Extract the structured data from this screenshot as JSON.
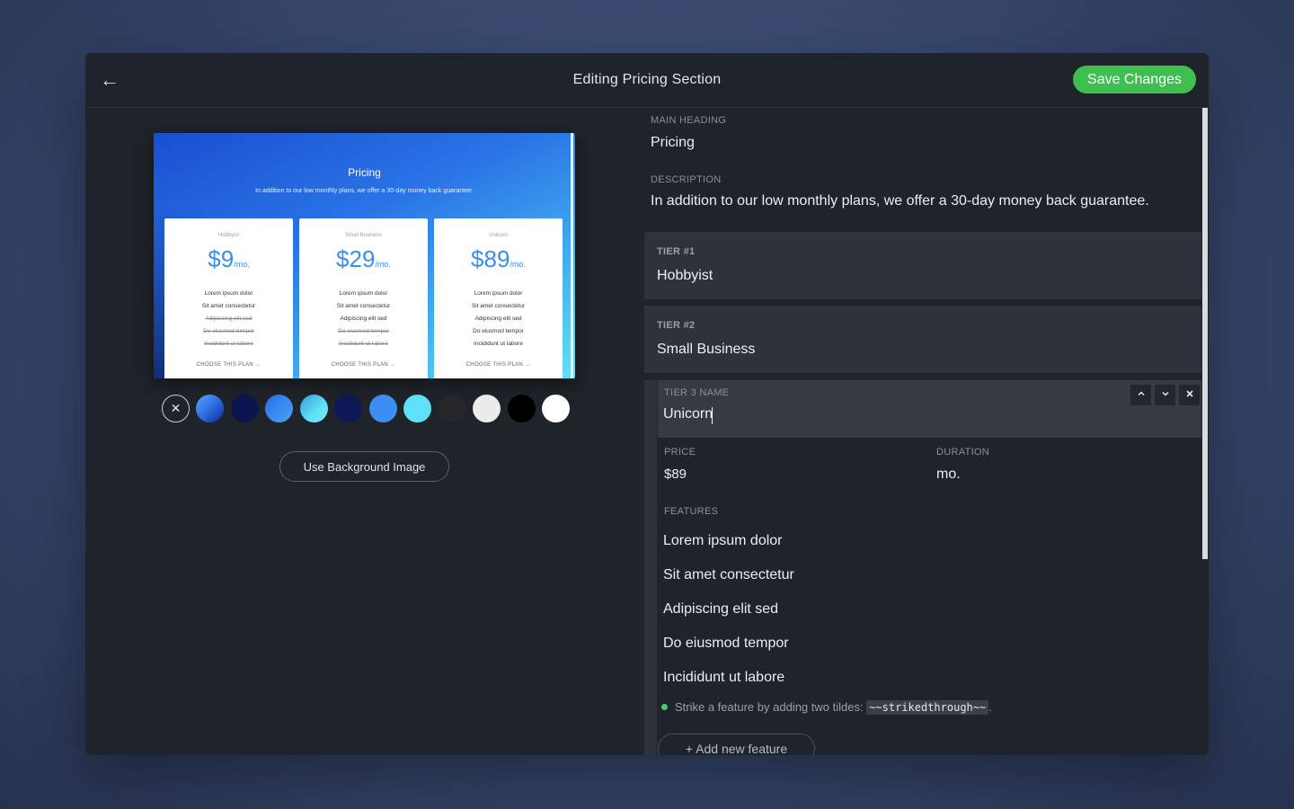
{
  "header": {
    "back_icon": "←",
    "title": "Editing Pricing Section",
    "save_label": "Save Changes"
  },
  "preview": {
    "title": "Pricing",
    "description": "In addition to our low monthly plans, we offer a 30-day money back guarantee.",
    "cards": [
      {
        "tier": "Hobbyist",
        "price": "$9",
        "per": "/mo.",
        "cta": "CHOOSE THIS PLAN →",
        "features": [
          {
            "text": "Lorem ipsum dolor",
            "struck": false
          },
          {
            "text": "Sit amet consectetur",
            "struck": false
          },
          {
            "text": "Adipiscing elit sed",
            "struck": true
          },
          {
            "text": "Do eiusmod tempor",
            "struck": true
          },
          {
            "text": "Incididunt ut labore",
            "struck": true
          }
        ]
      },
      {
        "tier": "Small Business",
        "price": "$29",
        "per": "/mo.",
        "cta": "CHOOSE THIS PLAN →",
        "features": [
          {
            "text": "Lorem ipsum dolor",
            "struck": false
          },
          {
            "text": "Sit amet consectetur",
            "struck": false
          },
          {
            "text": "Adipiscing elit sed",
            "struck": false
          },
          {
            "text": "Do eiusmod tempor",
            "struck": true
          },
          {
            "text": "Incididunt ut labore",
            "struck": true
          }
        ]
      },
      {
        "tier": "Unicorn",
        "price": "$89",
        "per": "/mo.",
        "cta": "CHOOSE THIS PLAN →",
        "features": [
          {
            "text": "Lorem ipsum dolor",
            "struck": false
          },
          {
            "text": "Sit amet consectetur",
            "struck": false
          },
          {
            "text": "Adipiscing elit sed",
            "struck": false
          },
          {
            "text": "Do eiusmod tempor",
            "struck": false
          },
          {
            "text": "Incididunt ut labore",
            "struck": false
          }
        ]
      }
    ]
  },
  "swatches": {
    "clear_icon": "✕",
    "colors": [
      "gradient-blue",
      "#0c1450",
      "gradient-mid-blue",
      "gradient-cyan",
      "#0e1856",
      "#3b8ef3",
      "#5fe0f6",
      "#25272b",
      "#ececec",
      "#000000",
      "#ffffff"
    ]
  },
  "background_button": "Use Background Image",
  "form": {
    "main_heading_label": "MAIN HEADING",
    "main_heading": "Pricing",
    "description_label": "DESCRIPTION",
    "description": "In addition to our low monthly plans, we offer a 30-day money back guarantee.",
    "tiers": [
      {
        "label": "TIER #1",
        "name": "Hobbyist"
      },
      {
        "label": "TIER #2",
        "name": "Small Business"
      }
    ],
    "tier3": {
      "name_label": "TIER 3 NAME",
      "name": "Unicorn",
      "price_label": "PRICE",
      "price": "$89",
      "duration_label": "DURATION",
      "duration": "mo.",
      "features_label": "FEATURES",
      "features": [
        "Lorem ipsum dolor",
        "Sit amet consectetur",
        "Adipiscing elit sed",
        "Do eiusmod tempor",
        "Incididunt ut labore"
      ],
      "hint_text": "Strike a feature by adding two tildes:",
      "hint_code": "~~strikedthrough~~",
      "hint_end": ".",
      "add_feature": "+ Add new feature",
      "move_up_icon": "chevron-up-icon",
      "move_down_icon": "chevron-down-icon",
      "remove_icon": "close-icon"
    }
  }
}
